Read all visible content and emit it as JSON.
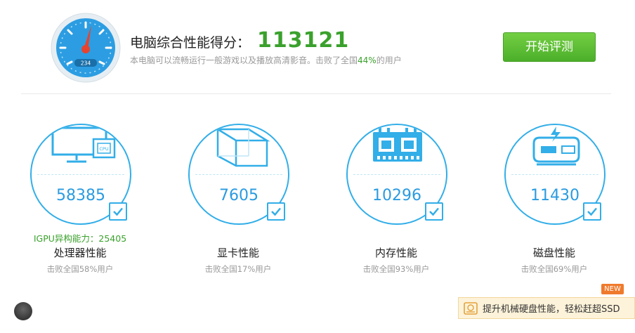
{
  "header": {
    "title": "电脑综合性能得分：",
    "score": "113121",
    "subtitle_prefix": "本电脑可以流畅运行一般游戏以及播放高清影音。击败了全国",
    "subtitle_percent": "44%",
    "subtitle_suffix": "的用户",
    "gauge_readout": "234",
    "start_button": "开始评测"
  },
  "cards": [
    {
      "value": "58385",
      "extra": "IGPU异构能力：25405",
      "name": "处理器性能",
      "desc": "击败全国58%用户",
      "icon": "cpu-monitor-icon",
      "icon_label": "CPU"
    },
    {
      "value": "7605",
      "name": "显卡性能",
      "desc": "击败全国17%用户",
      "icon": "gpu-cube-icon"
    },
    {
      "value": "10296",
      "name": "内存性能",
      "desc": "击败全国93%用户",
      "icon": "memory-chip-icon"
    },
    {
      "value": "11430",
      "name": "磁盘性能",
      "desc": "击败全国69%用户",
      "icon": "disk-drive-icon"
    }
  ],
  "footer": {
    "new_badge": "NEW",
    "ssd_promo": "提升机械硬盘性能，轻松赶超SSD"
  },
  "colors": {
    "accent_green": "#3aa12c",
    "ring_blue": "#32aee8",
    "value_blue": "#2a9be0",
    "badge_orange": "#f07a2c"
  }
}
